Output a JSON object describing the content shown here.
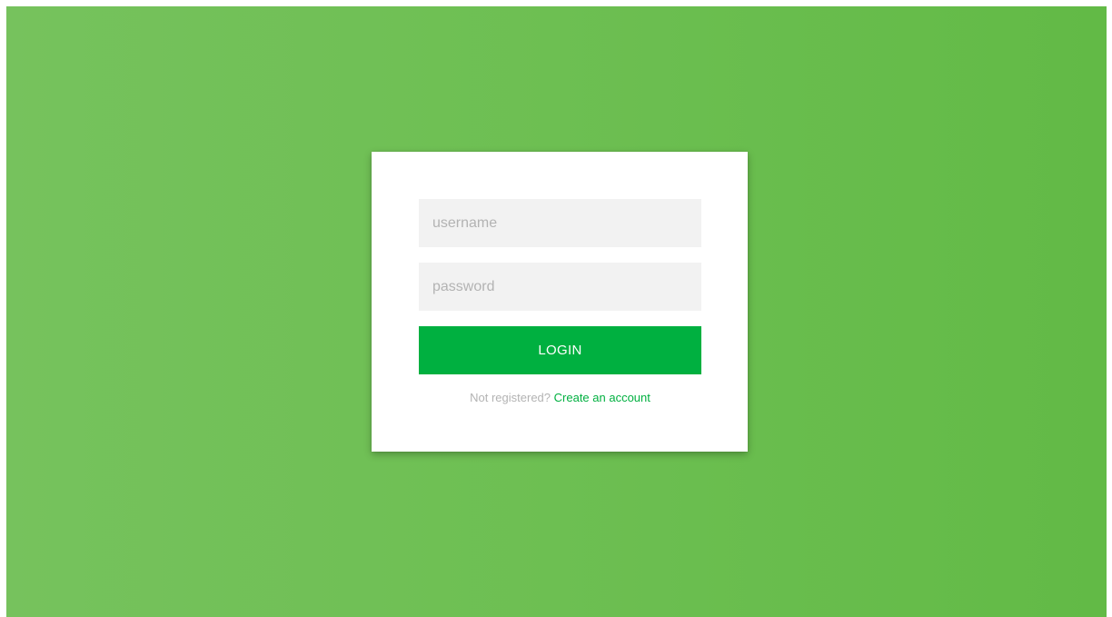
{
  "login": {
    "username_placeholder": "username",
    "password_placeholder": "password",
    "button_label": "LOGIN",
    "register_prompt": "Not registered?",
    "register_link": "Create an account"
  },
  "colors": {
    "background_left": "#76c25d",
    "background_right": "#62ba46",
    "accent": "#00b040",
    "field_background": "#f2f2f2"
  }
}
